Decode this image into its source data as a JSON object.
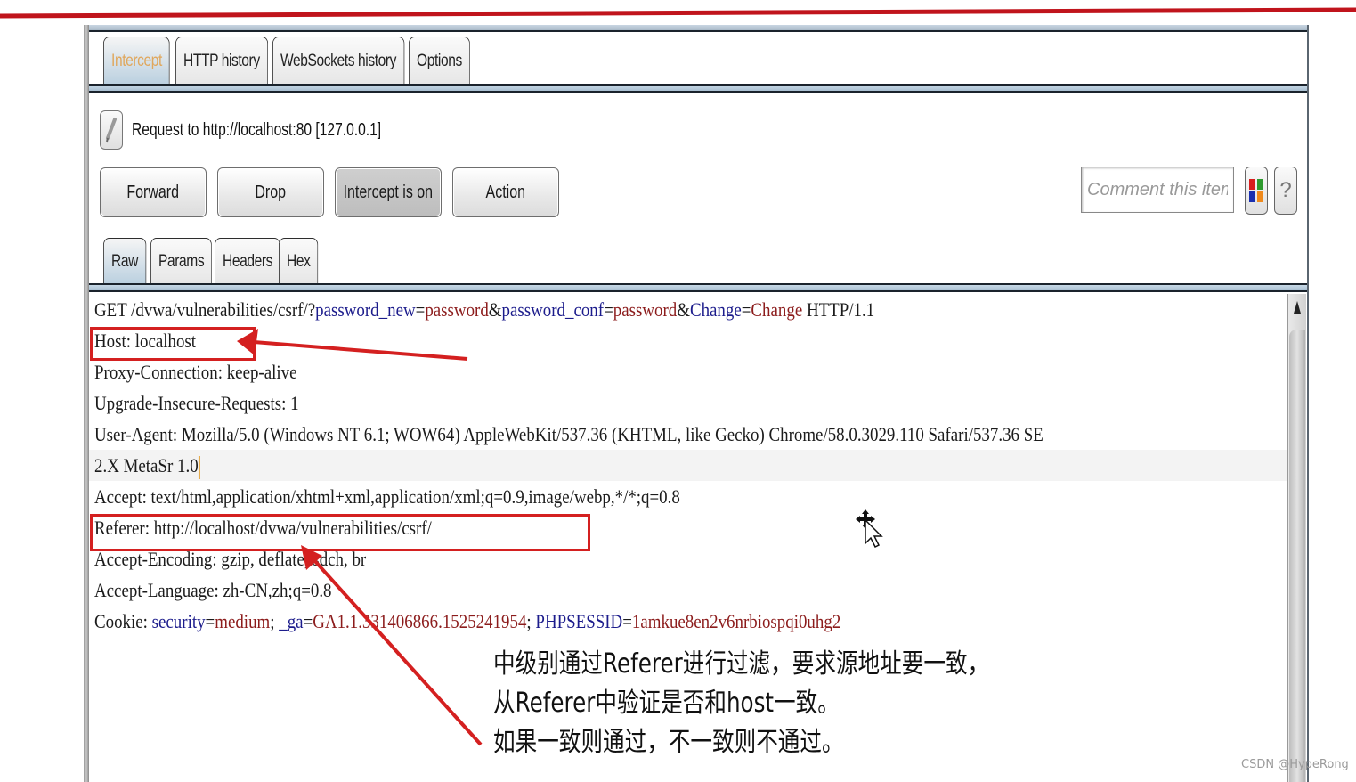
{
  "proxy_tabs": [
    {
      "label": "Intercept",
      "active": true
    },
    {
      "label": "HTTP history",
      "active": false
    },
    {
      "label": "WebSockets history",
      "active": false
    },
    {
      "label": "Options",
      "active": false
    }
  ],
  "request_info": {
    "label": "Request to http://localhost:80  [127.0.0.1]",
    "edit_icon": "pencil-icon"
  },
  "actions": {
    "forward": "Forward",
    "drop": "Drop",
    "intercept_toggle": "Intercept is on",
    "action": "Action"
  },
  "comment": {
    "placeholder": "Comment this item",
    "value": "",
    "highlight_icon": "color-grid-icon",
    "help_icon": "question-icon",
    "help_label": "?"
  },
  "message_tabs": [
    {
      "label": "Raw",
      "active": true
    },
    {
      "label": "Params",
      "active": false
    },
    {
      "label": "Headers",
      "active": false
    },
    {
      "label": "Hex",
      "active": false
    }
  ],
  "request": {
    "request_line": {
      "method_path": "GET /dvwa/vulnerabilities/csrf/?",
      "params": [
        {
          "name": "password_new",
          "value": "password"
        },
        {
          "name": "password_conf",
          "value": "password"
        },
        {
          "name": "Change",
          "value": "Change"
        }
      ],
      "protocol": " HTTP/1.1"
    },
    "headers": [
      "Host: localhost",
      "Proxy-Connection: keep-alive",
      "Upgrade-Insecure-Requests: 1",
      "User-Agent: Mozilla/5.0 (Windows NT 6.1; WOW64) AppleWebKit/537.36 (KHTML, like Gecko) Chrome/58.0.3029.110 Safari/537.36 SE",
      "2.X MetaSr 1.0",
      "Accept: text/html,application/xhtml+xml,application/xml;q=0.9,image/webp,*/*;q=0.8",
      "Referer: http://localhost/dvwa/vulnerabilities/csrf/",
      "Accept-Encoding: gzip, deflate, sdch, br",
      "Accept-Language: zh-CN,zh;q=0.8"
    ],
    "cookie": {
      "prefix": "Cookie: ",
      "items": [
        {
          "name": "security",
          "value": "medium"
        },
        {
          "name": "_ga",
          "value": "GA1.1.331406866.1525241954"
        },
        {
          "name": "PHPSESSID",
          "value": "1amkue8en2v6nrbiospqi0uhg2"
        }
      ]
    }
  },
  "annotation": {
    "lines": [
      "中级别通过Referer进行过滤，要求源地址要一致，",
      "从Referer中验证是否和host一致。",
      "如果一致则通过，不一致则不通过。"
    ],
    "highlighted": [
      "Host: localhost",
      "Referer: http://localhost/dvwa/vulnerabilities/csrf/"
    ],
    "color": "#d42020"
  },
  "watermark": "CSDN @HypeRong",
  "colors": {
    "param_name": "#1c1c8c",
    "param_value": "#8c1c1c",
    "intercept_tab_text": "#e0a75c"
  }
}
